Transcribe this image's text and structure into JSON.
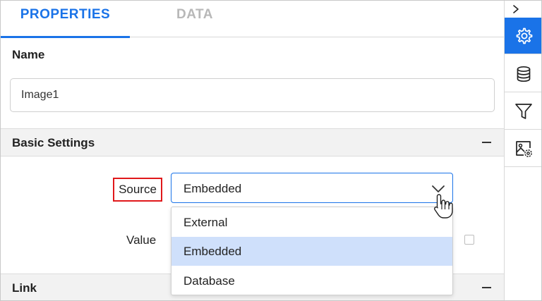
{
  "tabs": [
    {
      "label": "PROPERTIES",
      "active": true
    },
    {
      "label": "DATA",
      "active": false
    }
  ],
  "rail": {
    "collapse_icon": "chevron-right-icon",
    "buttons": [
      {
        "icon": "gear-icon",
        "active": true
      },
      {
        "icon": "database-icon",
        "active": false
      },
      {
        "icon": "filter-icon",
        "active": false
      },
      {
        "icon": "image-settings-icon",
        "active": false
      }
    ]
  },
  "name": {
    "label": "Name",
    "value": "Image1"
  },
  "basic_settings": {
    "title": "Basic Settings",
    "source": {
      "label": "Source",
      "selected": "Embedded",
      "options": [
        "External",
        "Embedded",
        "Database"
      ],
      "highlighted_index": 1
    },
    "value": {
      "label": "Value"
    }
  },
  "link": {
    "title": "Link"
  },
  "colors": {
    "accent": "#1a73e8",
    "highlight": "#cfe0fb",
    "callout_border": "#e0181b"
  }
}
